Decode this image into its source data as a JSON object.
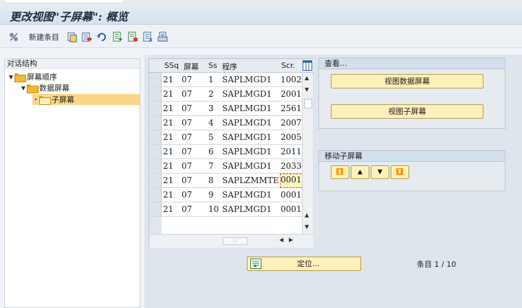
{
  "window": {
    "title": "更改视图\"子屏幕\": 概览"
  },
  "toolbar": {
    "new_entries_label": "新建条目",
    "icons": [
      "toggle-icon",
      "copy-icon",
      "delete-icon",
      "undo-icon",
      "select-all-icon",
      "select-block-icon",
      "deselect-all-icon",
      "print-icon"
    ]
  },
  "tree": {
    "header": "对话结构",
    "items": [
      {
        "label": "屏幕顺序",
        "level": 0,
        "expanded": true
      },
      {
        "label": "数据屏幕",
        "level": 1,
        "expanded": true
      },
      {
        "label": "子屏幕",
        "level": 2,
        "selected": true
      }
    ]
  },
  "table": {
    "columns": [
      "SSq",
      "屏幕",
      "Ss",
      "程序",
      "Scr."
    ],
    "rows": [
      [
        "21",
        "07",
        "1",
        "SAPLMGD1",
        "1002"
      ],
      [
        "21",
        "07",
        "2",
        "SAPLMGD1",
        "2001"
      ],
      [
        "21",
        "07",
        "3",
        "SAPLMGD1",
        "2561"
      ],
      [
        "21",
        "07",
        "4",
        "SAPLMGD1",
        "2007"
      ],
      [
        "21",
        "07",
        "5",
        "SAPLMGD1",
        "2005"
      ],
      [
        "21",
        "07",
        "6",
        "SAPLMGD1",
        "2011"
      ],
      [
        "21",
        "07",
        "7",
        "SAPLMGD1",
        "2033"
      ],
      [
        "21",
        "07",
        "8",
        "SAPLZMMTE…",
        "0001"
      ],
      [
        "21",
        "07",
        "9",
        "SAPLMGD1",
        "0001"
      ],
      [
        "21",
        "07",
        "10",
        "SAPLMGD1",
        "0001"
      ]
    ],
    "scroll_mid": ":::"
  },
  "view_group": {
    "title": "查看...",
    "view_data_screen": "视图数据屏幕",
    "view_subscreen": "视图子屏幕"
  },
  "move_group": {
    "title": "移动子屏幕",
    "buttons": [
      "move-first",
      "move-up",
      "move-down",
      "move-last"
    ]
  },
  "position_button": "定位...",
  "entry_count": "条目 1 / 10"
}
